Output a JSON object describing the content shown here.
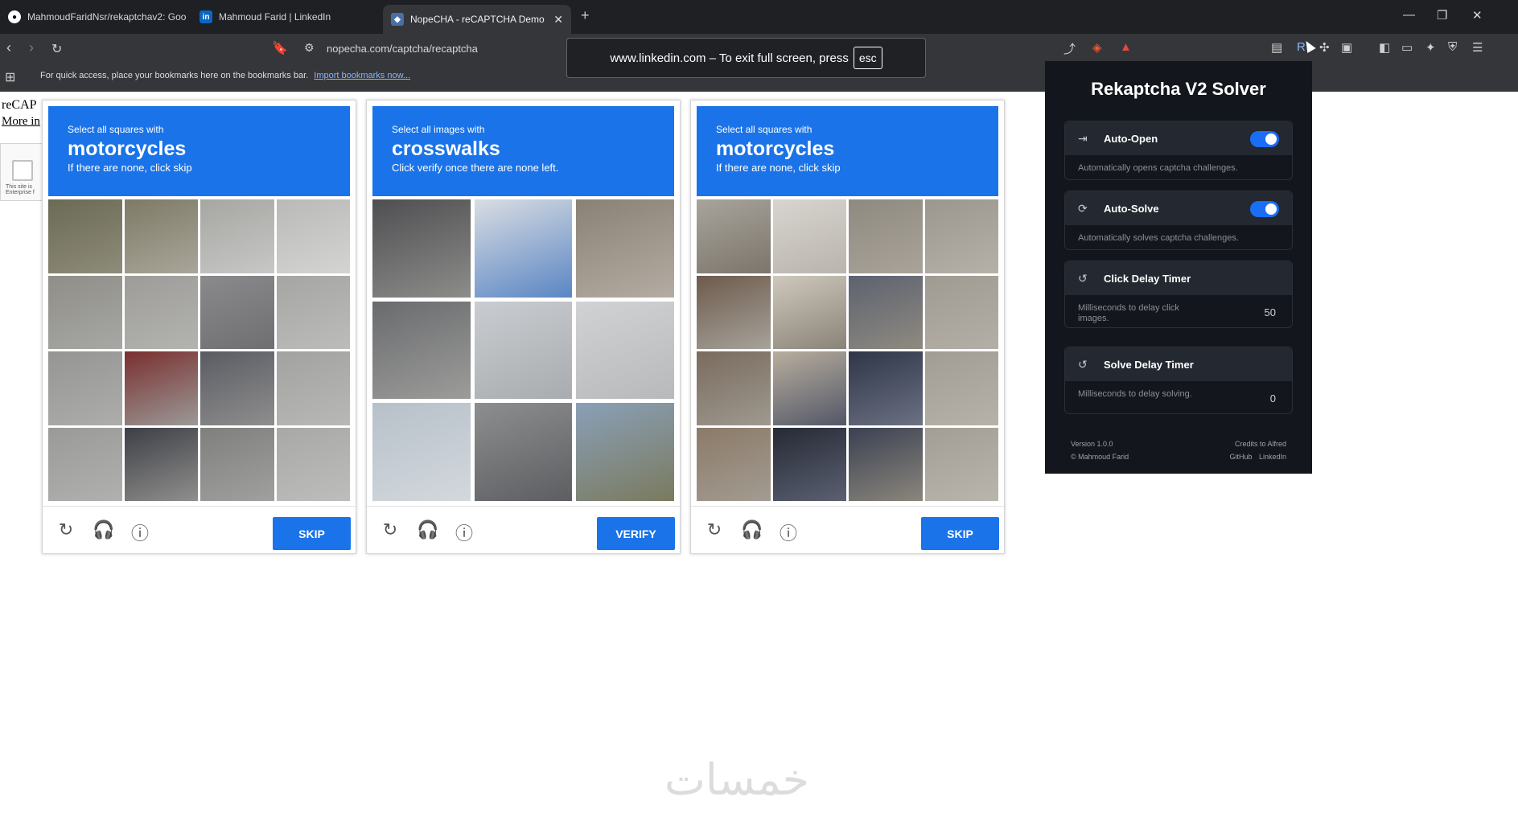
{
  "browser": {
    "tabs": [
      {
        "label": "MahmoudFaridNsr/rekaptchav2: Goo",
        "icon": "github-icon"
      },
      {
        "label": "Mahmoud Farid | LinkedIn",
        "icon": "linkedin-icon"
      },
      {
        "label": "NopeCHA - reCAPTCHA Demo",
        "icon": "nopecha-icon"
      }
    ],
    "url": "nopecha.com/captcha/recaptcha",
    "bookmarks_text": "For quick access, place your bookmarks here on the bookmarks bar.",
    "bookmarks_link": "Import bookmarks now...",
    "fullscreen_toast": "www.linkedin.com – To exit full screen, press",
    "esc_key": "esc"
  },
  "page": {
    "bg_title": "reCAP",
    "bg_more": "More in",
    "bg_small": "This site is Enterprise f"
  },
  "captchas": [
    {
      "line1": "Select all squares with",
      "target": "motorcycles",
      "line2": "If there are none, click skip",
      "button": "SKIP",
      "grid": "4x4"
    },
    {
      "line1": "Select all images with",
      "target": "crosswalks",
      "line2": "Click verify once there are none left.",
      "button": "VERIFY",
      "grid": "3x3"
    },
    {
      "line1": "Select all squares with",
      "target": "motorcycles",
      "line2": "If there are none, click skip",
      "button": "SKIP",
      "grid": "4x4"
    }
  ],
  "panel": {
    "title": "Rekaptcha V2 Solver",
    "settings": [
      {
        "label": "Auto-Open",
        "desc": "Automatically opens captcha challenges.",
        "toggle": true
      },
      {
        "label": "Auto-Solve",
        "desc": "Automatically solves captcha challenges.",
        "toggle": true
      },
      {
        "label": "Click Delay Timer",
        "desc": "Milliseconds to delay click images.",
        "value": "50"
      },
      {
        "label": "Solve Delay Timer",
        "desc": "Milliseconds to delay solving.",
        "value": "0"
      }
    ],
    "version": "Version 1.0.0",
    "author": "© Mahmoud Farid",
    "credits": "Credits to Alfred",
    "link1": "GitHub",
    "link2": "LinkedIn"
  },
  "watermark": "خمسات",
  "colors": {
    "accent": "#1a73e8",
    "panel_bg": "#13161c",
    "toggle_on": "#1a6ef5"
  }
}
